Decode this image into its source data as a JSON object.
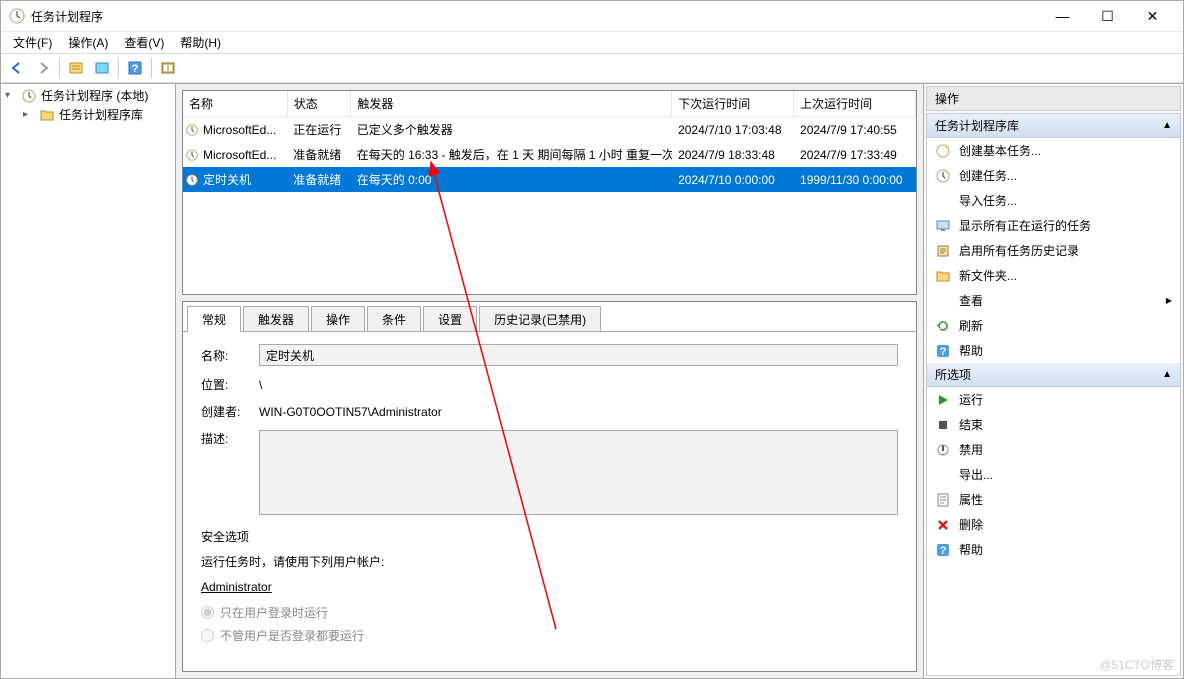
{
  "window": {
    "title": "任务计划程序"
  },
  "menubar": {
    "file": "文件(F)",
    "operation": "操作(A)",
    "view": "查看(V)",
    "help": "帮助(H)"
  },
  "tree": {
    "root": "任务计划程序 (本地)",
    "library": "任务计划程序库"
  },
  "task_list": {
    "headers": {
      "name": "名称",
      "status": "状态",
      "trigger": "触发器",
      "next_run": "下次运行时间",
      "last_run": "上次运行时间"
    },
    "rows": [
      {
        "name": "MicrosoftEd...",
        "status": "正在运行",
        "trigger": "已定义多个触发器",
        "next_run": "2024/7/10 17:03:48",
        "last_run": "2024/7/9 17:40:55"
      },
      {
        "name": "MicrosoftEd...",
        "status": "准备就绪",
        "trigger": "在每天的 16:33 - 触发后，在 1 天 期间每隔 1 小时 重复一次。",
        "next_run": "2024/7/9 18:33:48",
        "last_run": "2024/7/9 17:33:49"
      },
      {
        "name": "定时关机",
        "status": "准备就绪",
        "trigger": "在每天的 0:00",
        "next_run": "2024/7/10 0:00:00",
        "last_run": "1999/11/30 0:00:00"
      }
    ]
  },
  "detail": {
    "tabs": {
      "general": "常规",
      "triggers": "触发器",
      "actions": "操作",
      "conditions": "条件",
      "settings": "设置",
      "history": "历史记录(已禁用)"
    },
    "general": {
      "name_label": "名称:",
      "name_value": "定时关机",
      "location_label": "位置:",
      "location_value": "\\",
      "author_label": "创建者:",
      "author_value": "WIN-G0T0OOTIN57\\Administrator",
      "description_label": "描述:",
      "description_value": "",
      "security": {
        "title": "安全选项",
        "run_as_label": "运行任务时，请使用下列用户帐户:",
        "account": "Administrator",
        "radio1": "只在用户登录时运行",
        "radio2": "不管用户是否登录都要运行"
      }
    }
  },
  "actions_pane": {
    "header": "操作",
    "section1": {
      "title": "任务计划程序库",
      "items": [
        {
          "icon": "create-basic",
          "label": "创建基本任务..."
        },
        {
          "icon": "create",
          "label": "创建任务..."
        },
        {
          "icon": "import",
          "label": "导入任务..."
        },
        {
          "icon": "show-running",
          "label": "显示所有正在运行的任务"
        },
        {
          "icon": "enable-history",
          "label": "启用所有任务历史记录"
        },
        {
          "icon": "new-folder",
          "label": "新文件夹..."
        },
        {
          "icon": "view",
          "label": "查看",
          "arrow": true
        },
        {
          "icon": "refresh",
          "label": "刷新"
        },
        {
          "icon": "help",
          "label": "帮助"
        }
      ]
    },
    "section2": {
      "title": "所选项",
      "items": [
        {
          "icon": "run",
          "label": "运行"
        },
        {
          "icon": "end",
          "label": "结束"
        },
        {
          "icon": "disable",
          "label": "禁用"
        },
        {
          "icon": "export",
          "label": "导出..."
        },
        {
          "icon": "properties",
          "label": "属性"
        },
        {
          "icon": "delete",
          "label": "删除"
        },
        {
          "icon": "help",
          "label": "帮助"
        }
      ]
    }
  },
  "watermark": "@51CTO博客"
}
